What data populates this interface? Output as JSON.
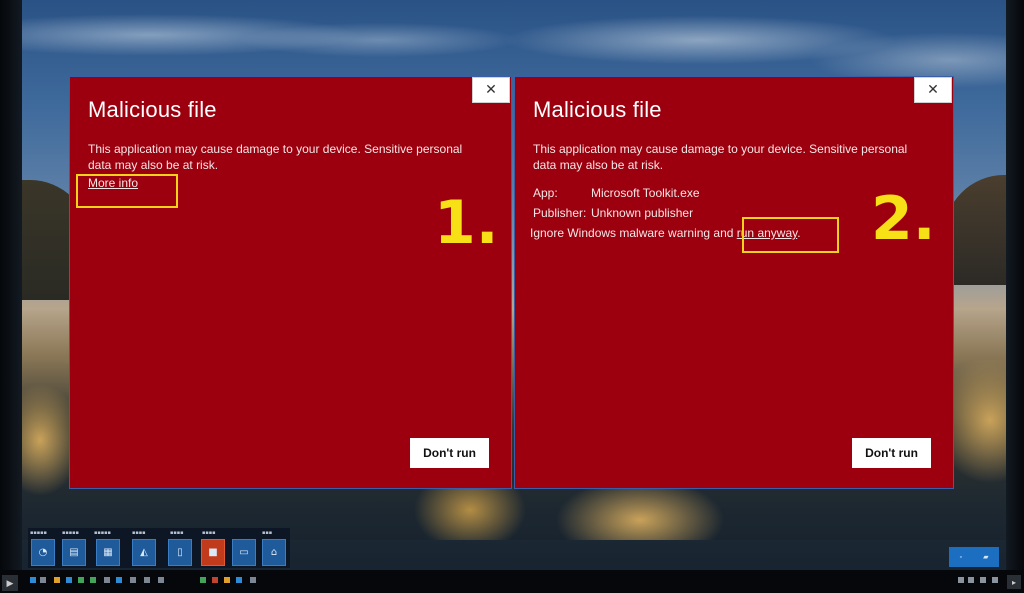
{
  "dialog1": {
    "title": "Malicious file",
    "message": "This application may cause damage to your device. Sensitive personal data may also be at risk.",
    "more_info": "More info",
    "step": "1.",
    "dont_run": "Don't run",
    "close_glyph": "✕"
  },
  "dialog2": {
    "title": "Malicious file",
    "message": "This application may cause damage to your device. Sensitive personal data may also be at risk.",
    "app_label": "App:",
    "app_value": "Microsoft Toolkit.exe",
    "publisher_label": "Publisher:",
    "publisher_value": "Unknown publisher",
    "warning_text": "Ignore Windows malware warning and ",
    "run_anyway": "run anyway",
    "period": ".",
    "step": "2.",
    "dont_run": "Don't run",
    "close_glyph": "✕"
  },
  "colors": {
    "dialog_bg": "#9c000e",
    "highlight": "#f2d21b",
    "step_number": "#f7e016"
  }
}
